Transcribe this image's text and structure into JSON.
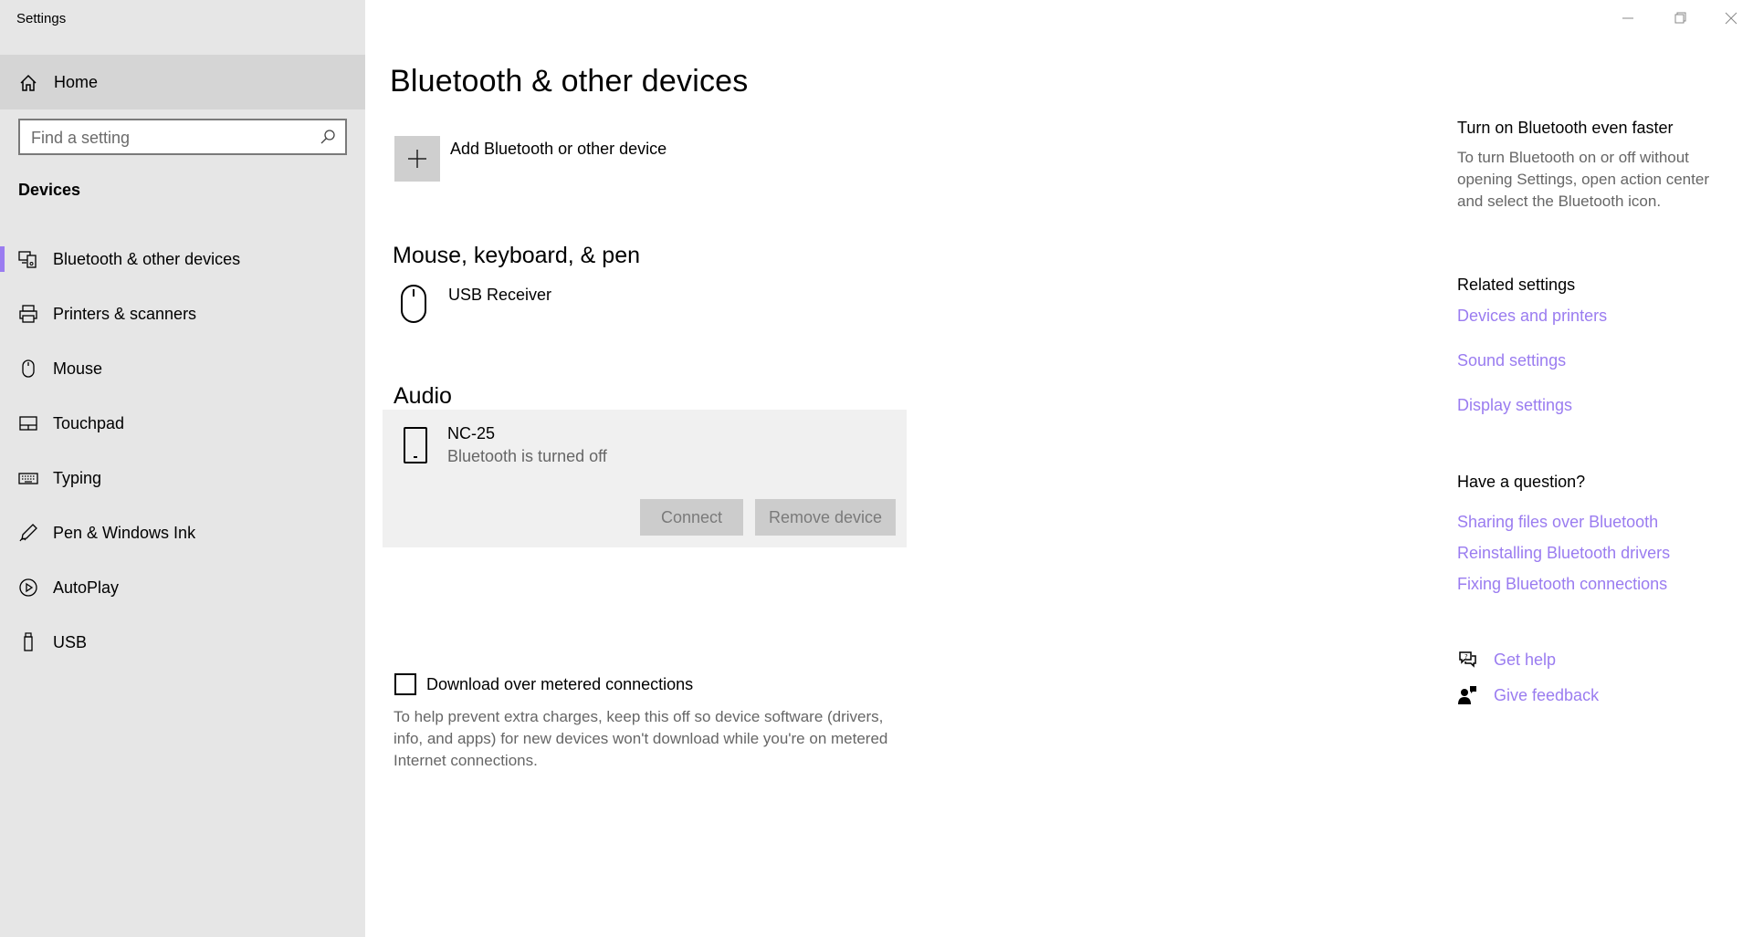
{
  "window": {
    "app_title": "Settings",
    "controls": [
      "minimize-icon",
      "restore-icon",
      "close-icon"
    ]
  },
  "sidebar": {
    "home_label": "Home",
    "search_placeholder": "Find a setting",
    "section_title": "Devices",
    "items": [
      {
        "label": "Bluetooth & other devices",
        "icon": "bluetooth-devices-icon",
        "active": true
      },
      {
        "label": "Printers & scanners",
        "icon": "printer-icon",
        "active": false
      },
      {
        "label": "Mouse",
        "icon": "mouse-icon",
        "active": false
      },
      {
        "label": "Touchpad",
        "icon": "touchpad-icon",
        "active": false
      },
      {
        "label": "Typing",
        "icon": "keyboard-icon",
        "active": false
      },
      {
        "label": "Pen & Windows Ink",
        "icon": "pen-icon",
        "active": false
      },
      {
        "label": "AutoPlay",
        "icon": "autoplay-icon",
        "active": false
      },
      {
        "label": "USB",
        "icon": "usb-icon",
        "active": false
      }
    ]
  },
  "main": {
    "title": "Bluetooth & other devices",
    "add_device_label": "Add Bluetooth or other device",
    "mouse_section": {
      "title": "Mouse, keyboard, & pen",
      "devices": [
        {
          "name": "USB Receiver",
          "icon": "mouse-icon"
        }
      ]
    },
    "audio_section": {
      "title": "Audio",
      "devices": [
        {
          "name": "NC-25",
          "status": "Bluetooth is turned off",
          "icon": "phone-icon"
        }
      ],
      "connect_label": "Connect",
      "remove_label": "Remove device"
    },
    "metered": {
      "label": "Download over metered connections",
      "checked": false,
      "description": "To help prevent extra charges, keep this off so device software (drivers, info, and apps) for new devices won't download while you're on metered Internet connections."
    }
  },
  "right": {
    "tip_title": "Turn on Bluetooth even faster",
    "tip_text": "To turn Bluetooth on or off without opening Settings, open action center and select the Bluetooth icon.",
    "related_title": "Related settings",
    "related_links": [
      "Devices and printers",
      "Sound settings",
      "Display settings"
    ],
    "question_title": "Have a question?",
    "question_links": [
      "Sharing files over Bluetooth",
      "Reinstalling Bluetooth drivers",
      "Fixing Bluetooth connections"
    ],
    "get_help": "Get help",
    "give_feedback": "Give feedback",
    "link_color": "#9a7cf0"
  }
}
